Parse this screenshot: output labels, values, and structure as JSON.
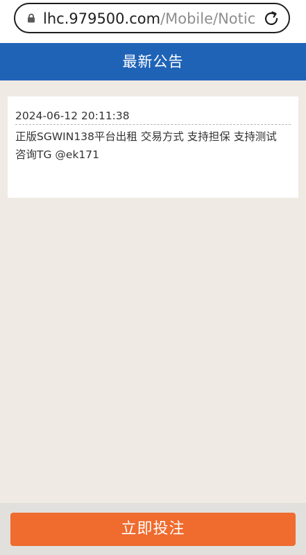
{
  "browser": {
    "url_host": "lhc.979500.com",
    "url_path": "/Mobile/Notic"
  },
  "header": {
    "title": "最新公告"
  },
  "notices": [
    {
      "datetime": "2024-06-12 20:11:38",
      "text": "正版SGWIN138平台出租 交易方式 支持担保 支持测试 咨询TG @ek171"
    }
  ],
  "footer": {
    "bet_label": "立即投注"
  },
  "colors": {
    "title_bar": "#1f63b7",
    "bet_button": "#ef6b2e",
    "page_background": "#efebe4"
  },
  "icons": {
    "lock": "lock-icon",
    "reload": "reload-icon"
  }
}
